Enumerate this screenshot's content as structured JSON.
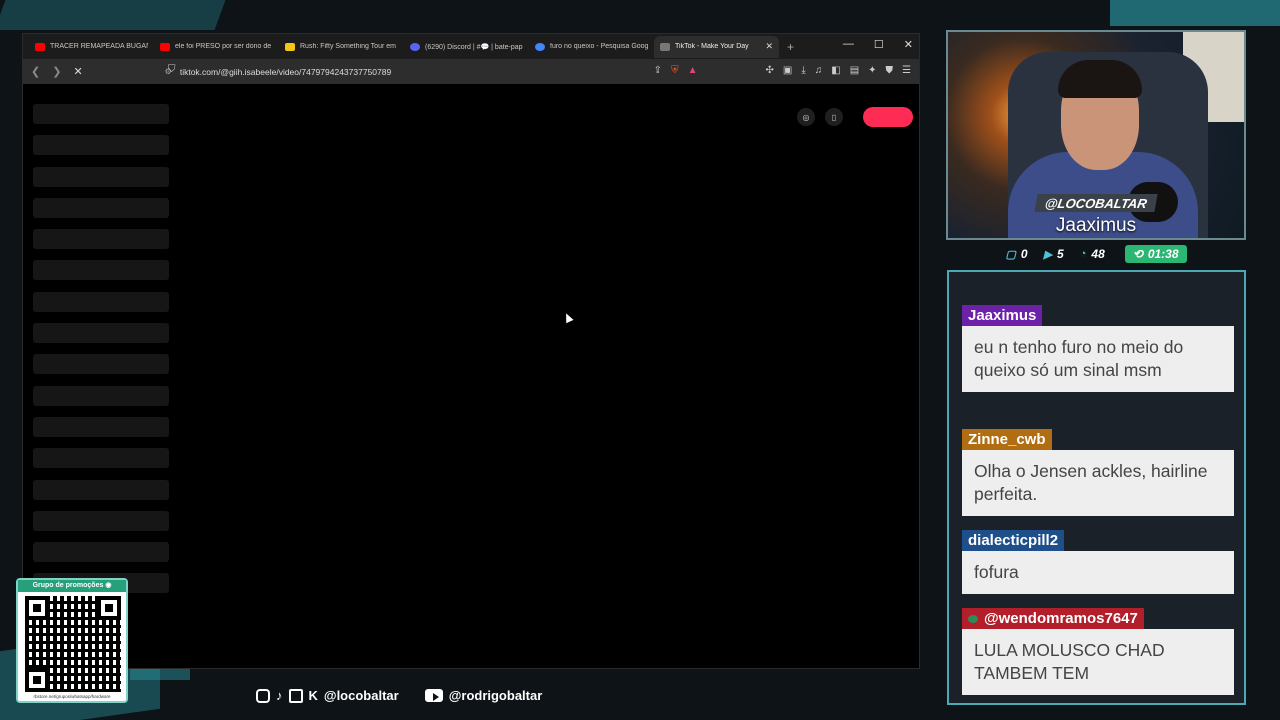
{
  "browser": {
    "tabs": [
      {
        "title": "TRACER REMAPEADA BUGANDO",
        "fav_color": "#ff0000",
        "icon": "youtube-icon"
      },
      {
        "title": "ele foi PRESO por ser dono de u",
        "fav_color": "#ff0000",
        "icon": "youtube-icon"
      },
      {
        "title": "Rush: Fifty Something Tour em 2",
        "fav_color": "#f5c518",
        "icon": "page-icon"
      },
      {
        "title": "(6290) Discord | #💬 | bate-papo",
        "fav_color": "#5865f2",
        "icon": "discord-icon"
      },
      {
        "title": "furo no queixo - Pesquisa Googl",
        "fav_color": "#4285f4",
        "icon": "google-icon"
      },
      {
        "title": "TikTok - Make Your Day",
        "fav_color": "#777777",
        "icon": "tiktok-icon"
      }
    ],
    "url": "tiktok.com/@giih.isabeele/video/7479794243737750789",
    "window_controls": {
      "minimize": "—",
      "maximize": "☐",
      "close": "✕"
    },
    "new_tab": "+",
    "active_tab_close": "✕"
  },
  "webcam": {
    "handle": "@LOCOBALTAR",
    "name": "Jaaximus",
    "stats": {
      "messages": "0",
      "videos": "5",
      "viewers": "48",
      "timer": "01:38"
    }
  },
  "chat": {
    "messages": [
      {
        "user": "Jaaximus",
        "text": "eu n tenho furo no meio do queixo só um sinal msm",
        "color": "#6b21a8"
      },
      {
        "user": "Zinne_cwb",
        "text": "Olha o Jensen ackles, hairline perfeita.",
        "color": "#b06d12"
      },
      {
        "user": "dialecticpill2",
        "text": "fofura",
        "color": "#1e4f8a"
      },
      {
        "user": "@wendomramos7647",
        "text": "LULA MOLUSCO CHAD TAMBEM TEM",
        "color": "#b21e2a"
      }
    ]
  },
  "qr": {
    "header": "Grupo de promoções",
    "url": "rbstore.net/grupos/whatsapp/hardware"
  },
  "socials": {
    "handle_1": "@locobaltar",
    "handle_2": "@rodrigobaltar"
  }
}
